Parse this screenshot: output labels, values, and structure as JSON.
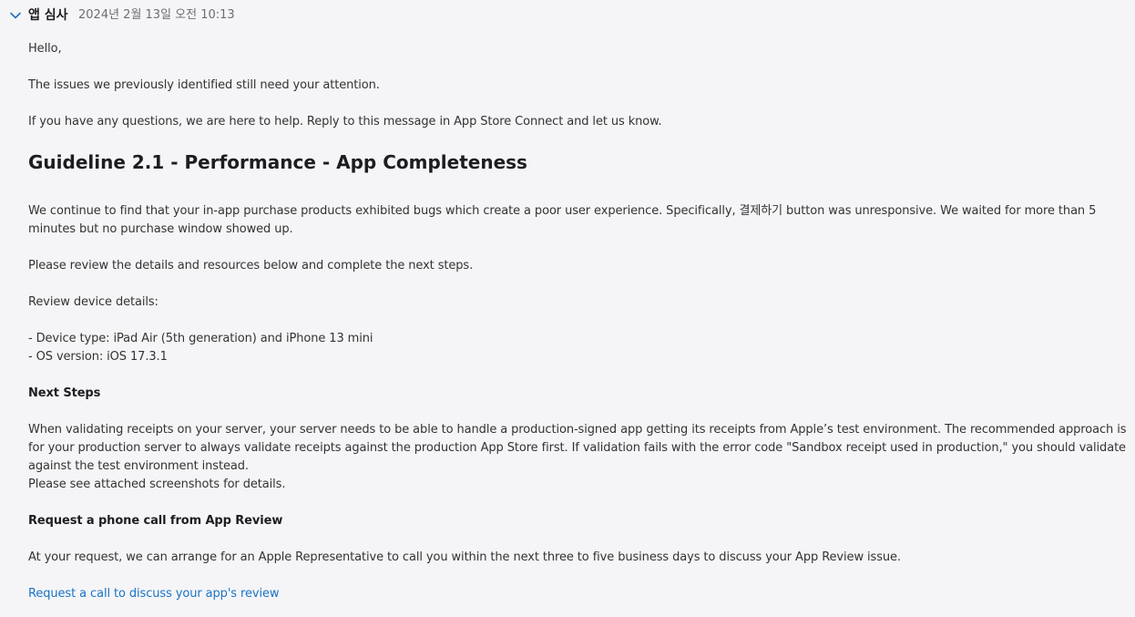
{
  "header": {
    "sender": "앱 심사",
    "timestamp": "2024년 2월 13일 오전 10:13",
    "toggle_icon": "chevron-down-icon"
  },
  "message": {
    "greeting": "Hello,",
    "line_attention": "The issues we previously identified still need your attention.",
    "line_questions": "If you have any questions, we are here to help. Reply to this message in App Store Connect and let us know.",
    "guideline_title": "Guideline 2.1 - Performance - App Completeness",
    "finding": "We continue to find that your in-app purchase products exhibited bugs which create a poor user experience. Specifically, 결제하기 button was unresponsive. We waited for more than 5 minutes but no purchase window showed up.",
    "review_instruction": "Please review the details and resources below and complete the next steps.",
    "device_details_label": "Review device details:",
    "device_type": "- Device type: iPad Air (5th generation) and iPhone 13 mini",
    "os_version": "- OS version: iOS 17.3.1",
    "next_steps_title": "Next Steps",
    "next_steps_text": "When validating receipts on your server, your server needs to be able to handle a production-signed app getting its receipts from Apple’s test environment. The recommended approach is for your production server to always validate receipts against the production App Store first. If validation fails with the error code \"Sandbox receipt used in production,\" you should validate against the test environment instead.",
    "screenshots_note": "Please see attached screenshots for details.",
    "phone_call_title": "Request a phone call from App Review",
    "phone_call_text": "At your request, we can arrange for an Apple Representative to call you within the next three to five business days to discuss your App Review issue.",
    "phone_call_link": "Request a call to discuss your app's review"
  },
  "colors": {
    "background": "#f5f5f7",
    "link": "#1a73c5",
    "chevron": "#1a73c5"
  }
}
